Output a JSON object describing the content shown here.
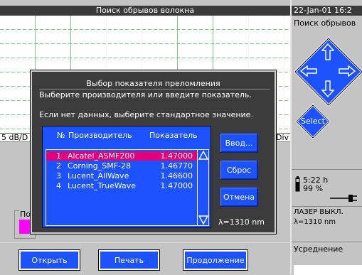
{
  "main": {
    "title": "Поиск обрывов волокна",
    "scale_left": "5 dB/D",
    "scale_right": "Div",
    "partial_label": "По"
  },
  "right_panel": {
    "date": "22-Jan-01 16:2",
    "title": "Поиск обрывов",
    "select_label": "Select",
    "battery_time": "5:22 h",
    "battery_percent": "99 %",
    "laser_state": "ЛАЗЕР ВЫКЛ.",
    "wavelength": "λ=1310 nm",
    "averaging": "Усреднение"
  },
  "dialog": {
    "title": "Выбор показателя преломления",
    "line1": "Выберите производителя или введите показатель.",
    "line2": "Если нет данных, выберите стандартное значение.",
    "headers": {
      "num": "№",
      "manufacturer": "Производитель",
      "index": "Показатель"
    },
    "rows": [
      {
        "num": "1",
        "name": "Alcatel_ASMF200",
        "value": "1.47000",
        "selected": true
      },
      {
        "num": "2",
        "name": "Corning_SMF-28",
        "value": "1.46770",
        "selected": false
      },
      {
        "num": "3",
        "name": "Lucent_AllWave",
        "value": "1.46600",
        "selected": false
      },
      {
        "num": "4",
        "name": "Lucent_TrueWave",
        "value": "1.47000",
        "selected": false
      }
    ],
    "buttons": {
      "enter": "Ввод...",
      "reset": "Сброс",
      "cancel": "Отмена"
    },
    "wavelength": "λ=1310 nm"
  },
  "bottom_buttons": {
    "open": "Открыть",
    "print": "Печать",
    "continue": "Продолжение"
  },
  "colors": {
    "accent": "#1c52ff",
    "selection": "#e0007c",
    "marker": "#ff00ff",
    "titlebar": "#3a3a3a"
  }
}
